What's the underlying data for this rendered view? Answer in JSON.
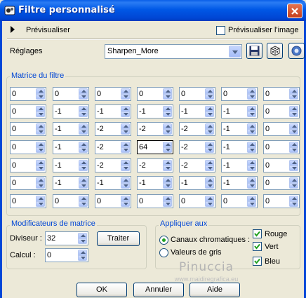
{
  "window": {
    "title": "Filtre personnalisé"
  },
  "preview": {
    "toggle_label": "Prévisualiser",
    "image_checkbox_label": "Prévisualiser l'image",
    "image_checked": false
  },
  "settings": {
    "label": "Réglages",
    "preset_value": "Sharpen_More"
  },
  "matrix": {
    "title": "Matrice du filtre",
    "rows": [
      [
        "0",
        "0",
        "0",
        "0",
        "0",
        "0",
        "0"
      ],
      [
        "0",
        "-1",
        "-1",
        "-1",
        "-1",
        "-1",
        "0"
      ],
      [
        "0",
        "-1",
        "-2",
        "-2",
        "-2",
        "-1",
        "0"
      ],
      [
        "0",
        "-1",
        "-2",
        "64",
        "-2",
        "-1",
        "0"
      ],
      [
        "0",
        "-1",
        "-2",
        "-2",
        "-2",
        "-1",
        "0"
      ],
      [
        "0",
        "-1",
        "-1",
        "-1",
        "-1",
        "-1",
        "0"
      ],
      [
        "0",
        "0",
        "0",
        "0",
        "0",
        "0",
        "0"
      ]
    ]
  },
  "modifiers": {
    "title": "Modificateurs de matrice",
    "divisor_label": "Diviseur :",
    "divisor_value": "32",
    "bias_label": "Calcul :",
    "bias_value": "0",
    "process_button": "Traiter"
  },
  "apply_to": {
    "title": "Appliquer aux",
    "chromatic_label": "Canaux chromatiques :",
    "chromatic_selected": true,
    "grayscale_label": "Valeurs de gris",
    "grayscale_selected": false,
    "red_label": "Rouge",
    "red_checked": true,
    "green_label": "Vert",
    "green_checked": true,
    "blue_label": "Bleu",
    "blue_checked": true
  },
  "watermark": {
    "name": "Pinuccia",
    "url": "www.maidiregrafica.eu"
  },
  "buttons": {
    "ok": "OK",
    "cancel": "Annuler",
    "help": "Aide"
  },
  "colors": {
    "title_bar": "#0058e6",
    "dialog_bg": "#ece9d8",
    "group_title": "#0046d5",
    "check_green": "#21a121"
  },
  "icons": [
    "app-icon",
    "close-icon",
    "play-icon",
    "dropdown-arrow-icon",
    "save-icon",
    "dice-icon",
    "circle-button-icon",
    "spin-up-icon",
    "spin-down-icon",
    "checkmark-icon"
  ]
}
